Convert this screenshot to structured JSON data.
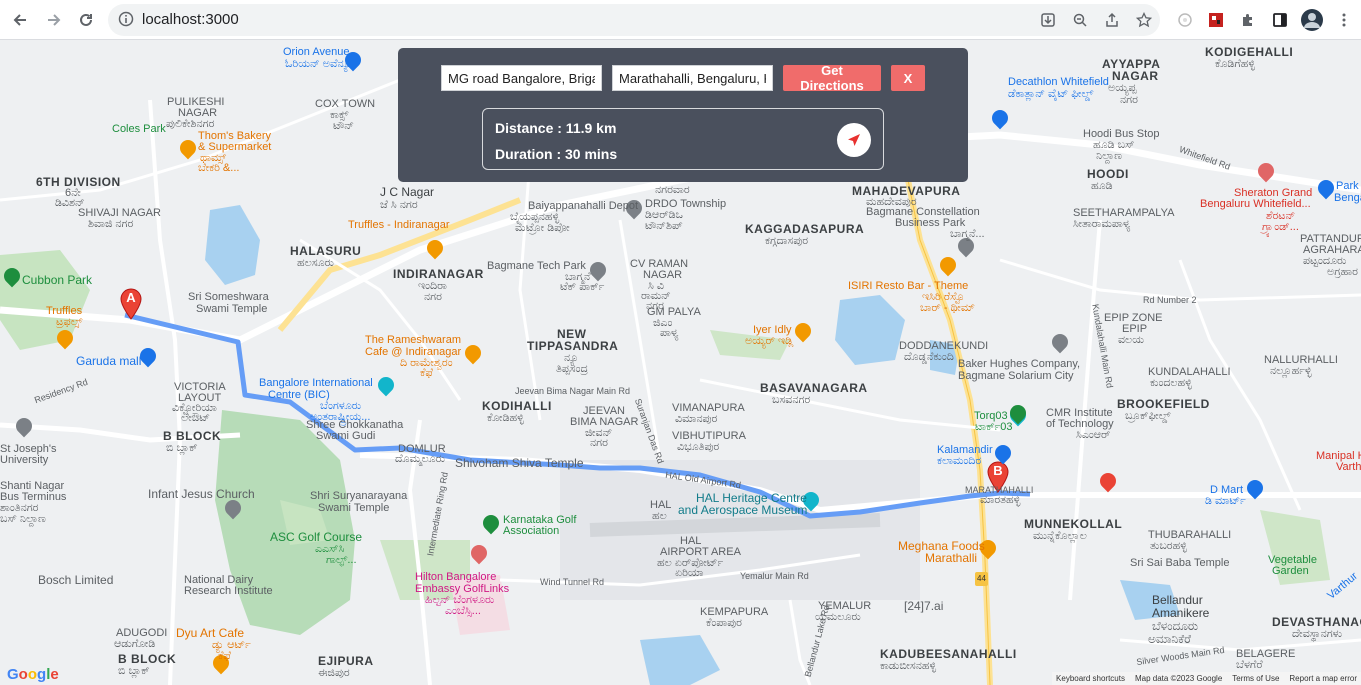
{
  "browser": {
    "url": "localhost:3000",
    "icons": [
      "back-icon",
      "forward-icon",
      "reload-icon",
      "info-icon",
      "install-icon",
      "zoom-icon",
      "share-icon",
      "star-icon",
      "extension-icon",
      "extension-red-icon",
      "puzzle-icon",
      "sidepanel-icon",
      "profile-avatar",
      "menu-icon"
    ]
  },
  "directions": {
    "origin_value": "MG road Bangalore, Brigade",
    "destination_value": "Marathahalli, Bengaluru, K",
    "get_directions_label": "Get Directions",
    "close_label": "X",
    "distance_text": "Distance : 11.9 km",
    "duration_text": "Duration : 30 mins",
    "accent_color": "#f06c6b",
    "panel_color": "#4a505d"
  },
  "markers": {
    "a_label": "A",
    "b_label": "B"
  },
  "map_labels": {
    "kodigehalli": "KODIGEHALLI",
    "kodigehalli_kn": "ಕೊಡಿಗೆಹಳ್ಳಿ",
    "orion": "Orion Avenue",
    "orion_kn": "ಓರಿಯನ್ ಅವೆನ್ಯೂ",
    "decathlon": "Decathlon Whitefield",
    "decathlon_kn": "ಡೆಕಾತ್ಲಾನ್ ವೈಟ್ ಫೀಲ್ಡ್",
    "ayyappa": "AYYAPPA",
    "ayyappa2": "NAGAR",
    "ayyappa_kn": "ಅಯ್ಯಪ್ಪ",
    "ayyappa_kn2": "ನಗರ",
    "pulikeshi": "PULIKESHI",
    "pulikeshi2": "NAGAR",
    "pulikeshi_kn": "ಪುಲಿಕೇಶಿನಗರ",
    "cox": "COX TOWN",
    "cox_kn": "ಕಾಕ್ಸ್",
    "cox_kn2": "ಟೌನ್",
    "coles": "Coles Park",
    "thoms": "Thom's Bakery",
    "thoms2": "& Supermarket",
    "thoms_kn": "ಥಾಮ್ಸ್",
    "thoms_kn2": "ಬೇಕರಿ &...",
    "hoodi_bus": "Hoodi Bus Stop",
    "hoodi_bus_kn": "ಹೂಡಿ ಬಸ್",
    "hoodi_bus_kn2": "ನಿಲ್ದಾಣ",
    "whitefield_rd": "Whitefield Rd",
    "sixth": "6TH DIVISION",
    "sixth_kn": "6ನೇ",
    "sixth_kn2": "ಡಿವಿಶನ್",
    "shivaji": "SHIVAJI NAGAR",
    "shivaji_kn": "ಶಿವಾಜಿ ನಗರ",
    "jc": "J C Nagar",
    "jc_kn": "ಜೆ ಸಿ ನಗರ",
    "nagar_kn": "ನಗರವಾರ",
    "baiyappa": "Baiyappanahalli Depot",
    "baiyappa_kn": "ಬೈಯಪ್ಪನಹಳ್ಳಿ",
    "baiyappa_kn2": "ಮೆಟ್ರೋ ಡಿಪೋ",
    "drdo": "DRDO Township",
    "drdo_kn": "ಡಿಆರ್‌ಡಿಒ",
    "drdo_kn2": "ಟೌನ್‌ಶಿಪ್",
    "mahadev": "MAHADEVAPURA",
    "mahadev_kn": "ಮಹದೇವಪುರ",
    "bagmane_c": "Bagmane Constellation",
    "bagmane_c2": "Business Park",
    "bagmane_c_kn": "ಬಾಗ್ಮನೆ...",
    "hoodi": "HOODI",
    "hoodi_kn": "ಹೂಡಿ",
    "sheraton": "Sheraton Grand",
    "sheraton2": "Bengaluru Whitefield...",
    "sheraton_kn": "ಶೆರಟನ್",
    "sheraton_kn2": "ಗ್ರ್ಯಾಂಡ್...",
    "seetharam": "SEETHARAMPALYA",
    "seetharam_kn": "ಸೀತಾರಾಮಪಾಳ್ಯ",
    "park": "Park",
    "park2": "Bengal",
    "pattandur": "PATTANDUR",
    "pattandur2": "AGRAHARA",
    "pattandur_kn": "ಪಟ್ಟಂದೂರು",
    "pattandur_kn2": "ಅಗ್ರಹಾರ",
    "truffles_indira": "Truffles - Indiranagar",
    "kaggadasa": "KAGGADASAPURA",
    "kaggadasa_kn": "ಕಗ್ಗದಾಸಪುರ",
    "halasuru": "HALASURU",
    "halasuru_kn": "ಹಲಸೂರು",
    "indira": "INDIRANAGAR",
    "indira_kn": "ಇಂದಿರಾ",
    "indira_kn2": "ನಗರ",
    "bagmane_tech": "Bagmane Tech Park",
    "bagmane_tech_kn": "ಬಾಗ್ಮನೆ",
    "bagmane_tech_kn2": "ಟೆಕ್ ಪಾರ್ಕ್",
    "cv": "CV RAMAN",
    "cv2": "NAGAR",
    "cv_kn": "ಸಿ ವಿ",
    "cv_kn2": "ರಾಮನ್",
    "cv_kn3": "ನಗರ",
    "isiri": "ISIRI Resto Bar - Theme",
    "isiri_kn": "ಇಸಿರಿ ರೆಸ್ಟೊ",
    "isiri_kn2": "ಬಾರ್ - ಥೀಮ್",
    "cubbon": "Cubbon Park",
    "someshwara": "Sri Someshwara",
    "someshwara2": "Swami Temple",
    "gm": "GM PALYA",
    "gm_kn": "ಜಿಎಂ",
    "gm_kn2": "ಪಾಳ್ಯ",
    "iyer": "Iyer Idly",
    "iyer_kn": "ಅಯ್ಯರ್ ಇಡ್ಲಿ",
    "rd_no2": "Rd Number 2",
    "epip": "EPIP ZONE",
    "epip_kn": "EPIP",
    "epip_kn2": "ವಲಯ",
    "truffles": "Truffles",
    "truffles_kn": "ಟ್ರಫಲ್ಸ್",
    "ramesh": "The Rameshwaram",
    "ramesh2": "Cafe @ Indiranagar",
    "ramesh_kn": "ದಿ ರಾಮೇಶ್ವರಂ",
    "ramesh_kn2": "ಕೆಫೆ",
    "new_tip": "NEW",
    "new_tip2": "TIPPASANDRA",
    "new_tip_kn": "ನ್ಯೂ",
    "new_tip_kn2": "ತಿಪ್ಪಸಂದ್ರ",
    "doddanek": "DODDANEKUNDI",
    "doddanek_kn": "ದೊಡ್ಡನೆಕುಂದಿ",
    "nallur": "NALLURHALLI",
    "nallur_kn": "ನಲ್ಲೂರ್ಹಳ್ಳಿ",
    "garuda": "Garuda mall",
    "bic": "Bangalore International",
    "bic2": "Centre (BIC)",
    "bic_kn": "ಬೆಂಗಳೂರು",
    "bic_kn2": "ಅಂತರಾಷ್ಟ್ರೀಯ...",
    "jeevan_rd": "Jeevan Bima Nagar Main Rd",
    "basava": "BASAVANAGARA",
    "basava_kn": "ಬಸವನಗರ",
    "baker": "Baker Hughes Company,",
    "baker2": "Bagmane Solarium City",
    "kundal": "KUNDALAHALLI",
    "kundal_kn": "ಕುಂದಲಹಳ್ಳಿ",
    "residency": "Residency Rd",
    "victoria": "VICTORIA",
    "victoria2": "LAYOUT",
    "victoria_kn": "ವಿಕ್ಟೋರಿಯಾ",
    "victoria_kn2": "ಲೇಔಟ್",
    "kodihalli": "KODIHALLI",
    "kodihalli_kn": "ಕೋಡಿಹಳ್ಳಿ",
    "jeevan": "JEEVAN",
    "jeevan2": "BIMA NAGAR",
    "jeevan_kn": "ಜೀವನ್",
    "jeevan_kn2": "ಭೀಮಾ",
    "jeevan_kn3": "ನಗರ",
    "vimana": "VIMANAPURA",
    "vimana_kn": "ವಿಮಾನಪುರ",
    "brookefield": "BROOKEFIELD",
    "brookefield_kn": "ಬ್ರೂಕ್‌ಫೀಲ್ಡ್",
    "torq": "Torq03",
    "torq_kn": "ಟಾರ್ಕ್03",
    "cmr": "CMR Institute",
    "cmr2": "of Technology",
    "cmr_kn": "ಸಿಎಂಆರ್",
    "joseph": "St Joseph's",
    "joseph2": "University",
    "bblock": "B BLOCK",
    "bblock_kn": "ಬಿ ಬ್ಲಾಕ್",
    "chokkanatha": "Shree Chokkanatha",
    "chokkanatha2": "Swami Gudi",
    "domlur": "DOMLUR",
    "domlur_kn": "ದೊಮ್ಮಲೂರು",
    "vibhuti": "VIBHUTIPURA",
    "vibhuti_kn": "ವಿಭೂತಿಪುರ",
    "kalamandir": "Kalamandir",
    "kalamandir_kn": "ಕಲಾಮಂದಿರ",
    "manipal": "Manipal H",
    "manipal2": "Varth",
    "shivoham": "Shivoham Shiva Temple",
    "hal_old": "HAL Old Airport Rd",
    "shanti": "Shanti Nagar",
    "shanti2": "Bus Terminus",
    "shanti_kn": "ಶಾಂತಿನಗರ",
    "shanti_kn2": "ಬಸ್ ನಿಲ್ದಾಣ",
    "infant": "Infant Jesus Church",
    "marath": "MARATHAHALLI",
    "marath_kn": "ಮಾರತಹಳ್ಳಿ",
    "dmart": "D Mart",
    "dmart_kn": "ಡಿ ಮಾರ್ಟ್",
    "hal": "HAL",
    "hal_kn": "ಹಲ",
    "hal_museum": "HAL Heritage Centre",
    "hal_museum2": "and Aerospace Museum",
    "surya": "Shri Suryanarayana",
    "surya2": "Swami Temple",
    "munne": "MUNNEKOLLAL",
    "munne_kn": "ಮುನ್ನೆಕೊಲ್ಲಾಲ",
    "asc": "ASC Golf Course",
    "asc_kn": "ಎಎಸ್‌ಸಿ",
    "asc_kn2": "ಗಾಲ್ಫ್...",
    "karnataka_golf": "Karnataka Golf",
    "karnataka_golf2": "Association",
    "hal_airport": "HAL",
    "hal_airport2": "AIRPORT AREA",
    "hal_airport_kn": "ಹಲ ಏರ್‌ಪೋರ್ಟ್",
    "hal_airport_kn2": "ಏರಿಯಾ",
    "thubara": "THUBARAHALLI",
    "thubara_kn": "ತುಬರಹಳ್ಳಿ",
    "meghana": "Meghana Foods",
    "meghana2": "Marathalli",
    "hilton": "Hilton Bangalore",
    "hilton2": "Embassy GolfLinks",
    "hilton_kn": "ಹಿಲ್ಟನ್ ಬೆಂಗಳೂರು",
    "hilton_kn2": "ಎಂಬೆಸ್ಸಿ...",
    "sai": "Sri Sai Baba Temple",
    "veg": "Vegetable",
    "veg2": "Garden",
    "bosch": "Bosch Limited",
    "national": "National Dairy",
    "national2": "Research Institute",
    "wind": "Wind Tunnel Rd",
    "yemalur_rd": "Yemalur Main Rd",
    "bellandur": "Bellandur",
    "bellandur2": "Amanikere",
    "bellandur_kn": "ಬೆಳಂದೂರು",
    "bellandur_kn2": "ಅಮಾನಿಕೆರೆ",
    "varthur": "Varthur",
    "adugodi": "ADUGODI",
    "adugodi_kn": "ಆಡುಗೋಡಿ",
    "dyu": "Dyu Art Cafe",
    "dyu_kn": "ಡ್ಯು ಆರ್ಟ್",
    "dyu_kn2": "ಕೆಫೆ",
    "kempa": "KEMPAPURA",
    "kempa_kn": "ಕೆಂಪಾಪುರ",
    "yemalur": "YEMALUR",
    "yemalur_kn": "ಯಮಲೂರು",
    "twentyfour": "[24]7.ai",
    "devas": "DEVASTHANAGALU",
    "devas_kn": "ದೇವಸ್ಥಾನಗಳು",
    "bblock2": "B BLOCK",
    "bblock2_kn": "ಬಿ ಬ್ಲಾಕ್",
    "ejipura": "EJIPURA",
    "ejipura_kn": "ಈಜಿಪುರ",
    "kadubee": "KADUBEESANAHALLI",
    "kadubee_kn": "ಕಾಡುಬೀಸನಹಳ್ಳಿ",
    "bellandur_lake_rd": "Bellandur Lake Rd",
    "silver": "Silver Woods Main Rd",
    "belagere": "BELAGERE",
    "belagere_kn": "ಬೆಳಗೆರೆ",
    "hebbal_ring": "Intermediate Ring Rd",
    "suranjan": "Suranjan Das Rd",
    "kundalahalli_rd": "Kundalahalli Main Rd",
    "ring44": "44",
    "google": "Google",
    "keyboard": "Keyboard shortcuts",
    "mapdata": "Map data ©2023 Google",
    "terms": "Terms of Use",
    "report": "Report a map error"
  }
}
